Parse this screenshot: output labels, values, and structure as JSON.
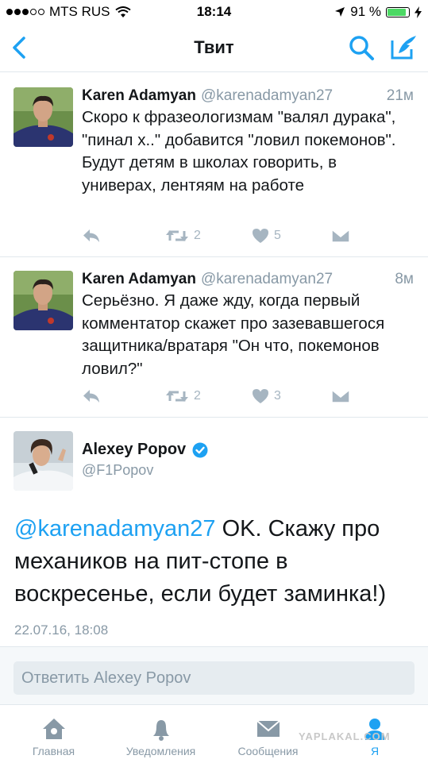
{
  "status_bar": {
    "carrier": "MTS RUS",
    "time": "18:14",
    "battery": "91 %",
    "battery_level": 0.91
  },
  "nav": {
    "title": "Твит"
  },
  "tweets": [
    {
      "name": "Karen Adamyan",
      "handle": "@karenadamyan27",
      "time": "21м",
      "text": "Скоро к фразеологизмам \"валял дурака\", \"пинал х..\" добавится \"ловил покемонов\". Будут детям в школах говорить, в универах, лентяям на работе",
      "retweets": "2",
      "likes": "5"
    },
    {
      "name": "Karen Adamyan",
      "handle": "@karenadamyan27",
      "time": "8м",
      "text": "Серьёзно. Я даже жду, когда первый комментатор скажет про зазевавшегося защитника/вратаря \"Он что, покемонов ловил?\"",
      "retweets": "2",
      "likes": "3"
    }
  ],
  "main_tweet": {
    "name": "Alexey Popov",
    "handle": "@F1Popov",
    "mention": "@karenadamyan27",
    "text": " OK. Скажу про механиков на пит-стопе в воскресенье, если будет заминка!)",
    "date": "22.07.16, 18:08"
  },
  "reply": {
    "placeholder": "Ответить Alexey Popov"
  },
  "tabs": [
    {
      "label": "Главная",
      "icon": "home-icon"
    },
    {
      "label": "Уведомления",
      "icon": "bell-icon"
    },
    {
      "label": "Сообщения",
      "icon": "envelope-icon"
    },
    {
      "label": "Я",
      "icon": "person-icon"
    }
  ],
  "watermark": "YAPLAKAL.COM",
  "colors": {
    "accent": "#1da1f2",
    "secondary_text": "#8899a6",
    "action_icons": "#a6b5c1",
    "verified": "#1da1f2"
  }
}
